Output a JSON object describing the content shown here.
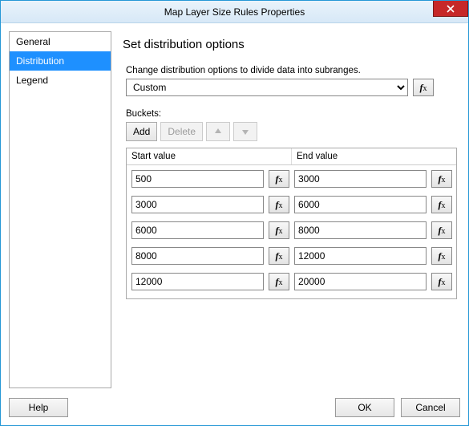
{
  "title": "Map Layer Size Rules Properties",
  "sidebar": {
    "items": [
      {
        "label": "General"
      },
      {
        "label": "Distribution"
      },
      {
        "label": "Legend"
      }
    ],
    "selected_index": 1
  },
  "main": {
    "heading": "Set distribution options",
    "description": "Change distribution options to divide data into subranges.",
    "distribution_select": "Custom",
    "buckets_label": "Buckets:",
    "toolbar": {
      "add": "Add",
      "delete": "Delete"
    },
    "columns": {
      "start": "Start value",
      "end": "End value"
    },
    "rows": [
      {
        "start": "500",
        "end": "3000"
      },
      {
        "start": "3000",
        "end": "6000"
      },
      {
        "start": "6000",
        "end": "8000"
      },
      {
        "start": "8000",
        "end": "12000"
      },
      {
        "start": "12000",
        "end": "20000"
      }
    ]
  },
  "footer": {
    "help": "Help",
    "ok": "OK",
    "cancel": "Cancel"
  },
  "fx_label": {
    "f": "f",
    "x": "x"
  }
}
